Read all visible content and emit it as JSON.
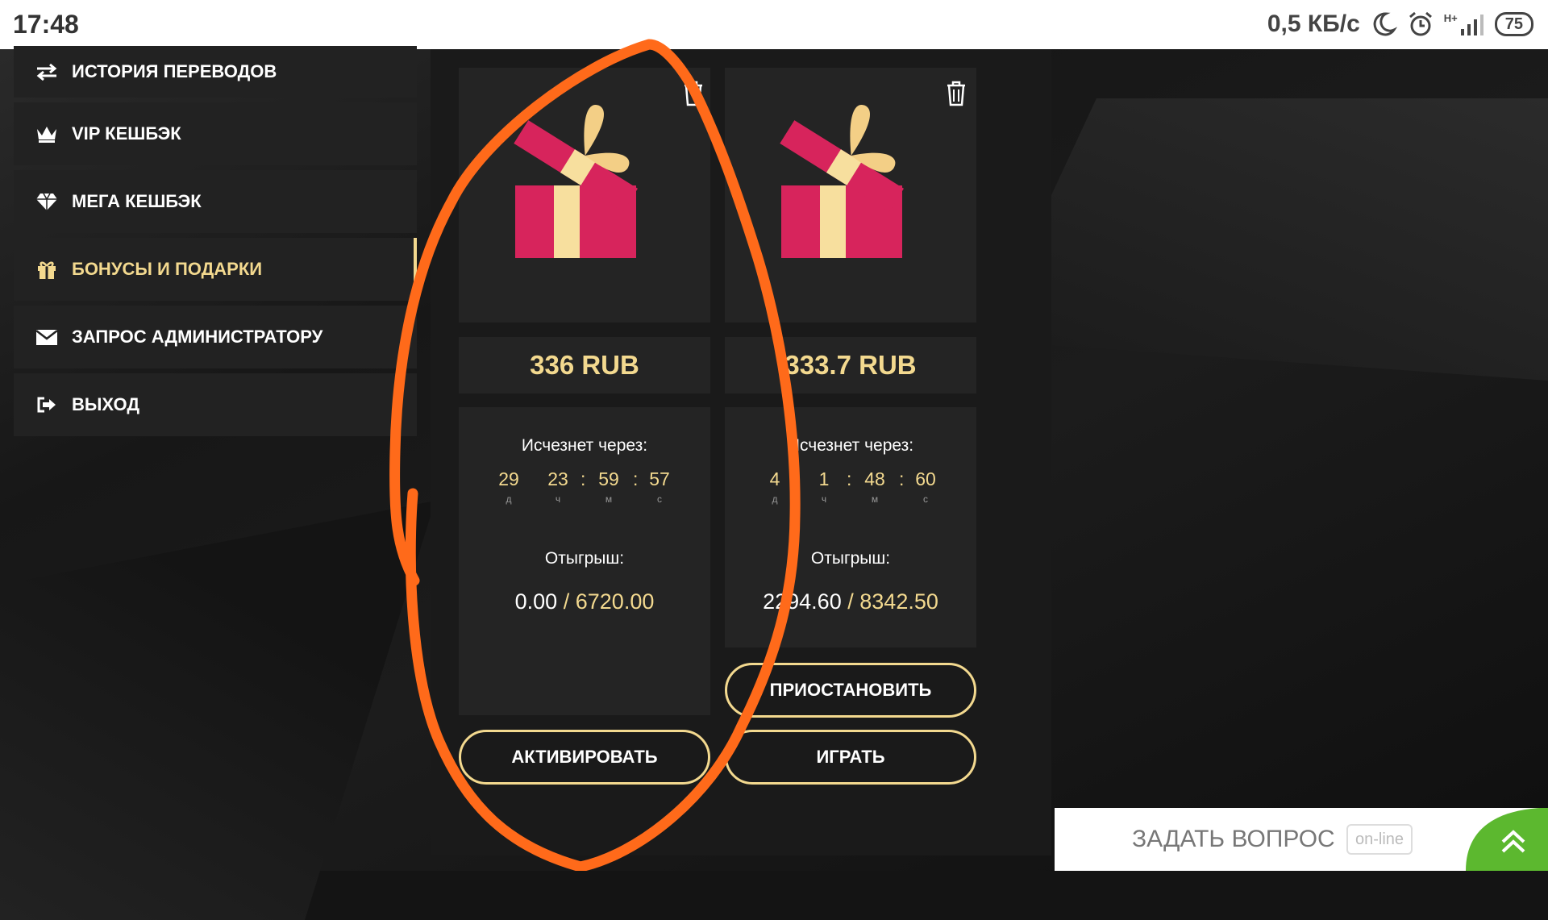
{
  "status_bar": {
    "time": "17:48",
    "speed": "0,5 КБ/с",
    "network": "H+",
    "battery": "75"
  },
  "sidebar": {
    "items": [
      {
        "label": "ИСТОРИЯ ПЕРЕВОДОВ",
        "icon": "transfer-arrows-icon"
      },
      {
        "label": "VIP КЕШБЭК",
        "icon": "crown-icon"
      },
      {
        "label": "МЕГА КЕШБЭК",
        "icon": "diamond-icon"
      },
      {
        "label": "БОНУСЫ И ПОДАРКИ",
        "icon": "gift-icon",
        "active": true
      },
      {
        "label": "ЗАПРОС АДМИНИСТРАТОРУ",
        "icon": "envelope-icon"
      },
      {
        "label": "ВЫХОД",
        "icon": "logout-icon"
      }
    ]
  },
  "bonuses": [
    {
      "amount": "336 RUB",
      "disappear_label": "Исчезнет через:",
      "timer": {
        "days": "29",
        "hours": "23",
        "minutes": "59",
        "seconds": "57"
      },
      "units": {
        "d": "д",
        "h": "ч",
        "m": "м",
        "s": "с"
      },
      "wager_label": "Отыгрыш:",
      "wager_done": "0.00",
      "wager_total": "6720.00",
      "buttons": [
        "АКТИВИРОВАТЬ"
      ]
    },
    {
      "amount": "333.7 RUB",
      "disappear_label": "Исчезнет через:",
      "timer": {
        "days": "4",
        "hours": "1",
        "minutes": "48",
        "seconds": "60"
      },
      "units": {
        "d": "д",
        "h": "ч",
        "m": "м",
        "s": "с"
      },
      "wager_label": "Отыгрыш:",
      "wager_done": "2294.60",
      "wager_total": "8342.50",
      "buttons": [
        "ПРИОСТАНОВИТЬ",
        "ИГРАТЬ"
      ]
    }
  ],
  "slash": "/",
  "chat": {
    "label": "ЗАДАТЬ ВОПРОС",
    "status": "on-line"
  },
  "colors": {
    "accent": "#f3d98f",
    "annotation": "#ff6a1a",
    "chat_green": "#5cb82f"
  }
}
